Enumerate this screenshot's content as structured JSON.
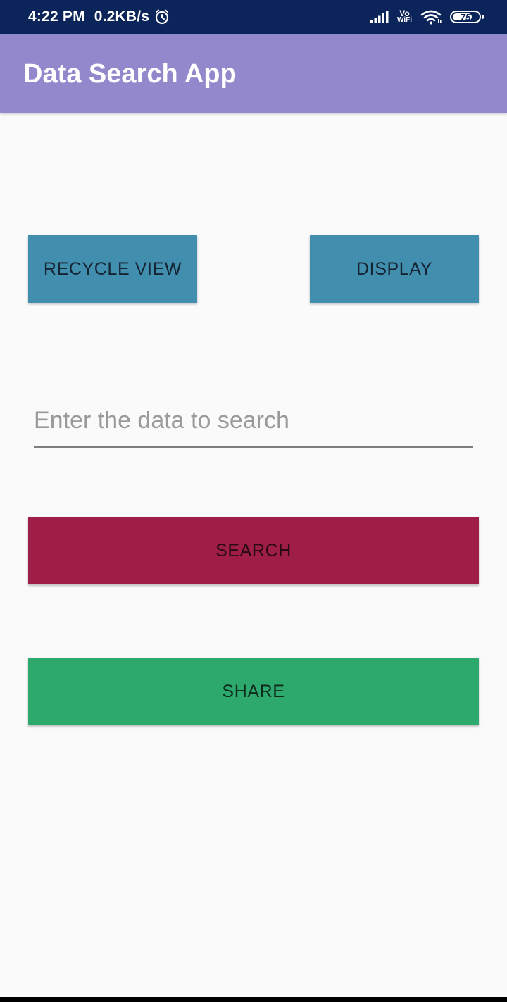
{
  "status_bar": {
    "time": "4:22 PM",
    "network_speed": "0.2KB/s",
    "vowifi_top": "Vo",
    "vowifi_bottom": "WiFi",
    "battery_level": "75",
    "battery_percent": 75,
    "icons": [
      "alarm-icon",
      "signal-icon",
      "vowifi-icon",
      "wifi-icon",
      "battery-icon"
    ]
  },
  "app_bar": {
    "title": "Data Search App",
    "color": "#9388cc"
  },
  "buttons": {
    "recycle_view": "RECYCLE VIEW",
    "display": "DISPLAY",
    "search": "SEARCH",
    "share": "SHARE"
  },
  "search": {
    "placeholder": "Enter the data to search",
    "value": ""
  },
  "colors": {
    "status_bar": "#0b2459",
    "app_bar": "#9388cc",
    "blue_button": "#428eae",
    "search_button": "#9e1e48",
    "share_button": "#2da96e",
    "background": "#fafafa"
  }
}
